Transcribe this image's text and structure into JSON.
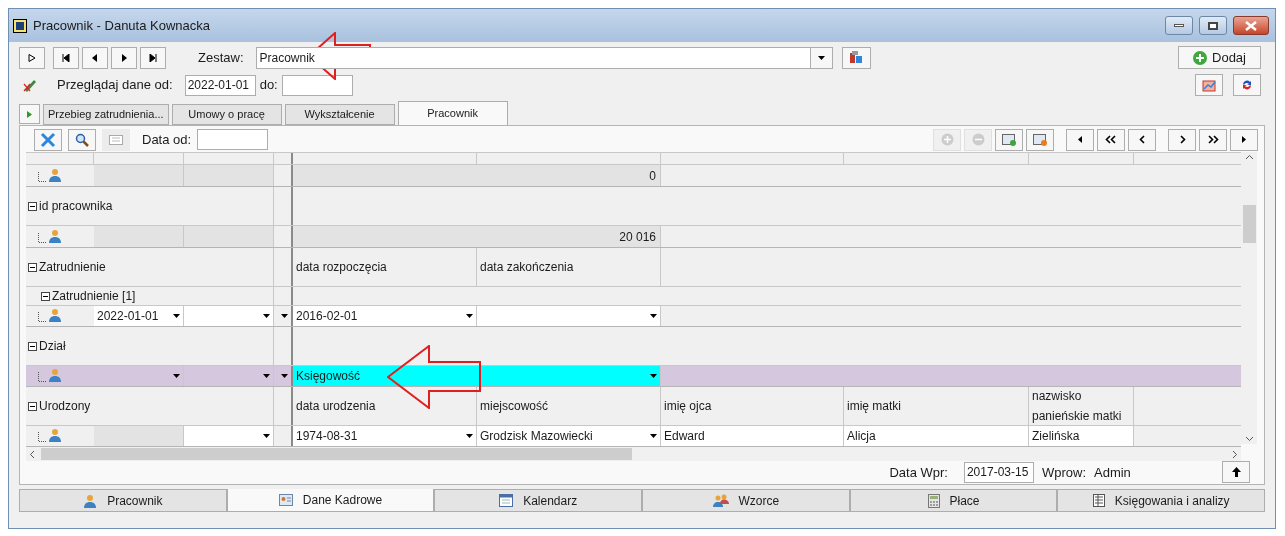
{
  "window": {
    "title": "Pracownik - Danuta Kownacka"
  },
  "toolbar": {
    "set_label": "Zestaw:",
    "set_value": "Pracownik",
    "add_button": "Dodaj",
    "browse_label": "Przeglądaj dane od:",
    "from_value": "2022-01-01",
    "to_label": "do:"
  },
  "tabs": [
    {
      "label": "Przebieg zatrudnienia...",
      "selected": false
    },
    {
      "label": "Umowy o pracę",
      "selected": false
    },
    {
      "label": "Wykształcenie",
      "selected": false
    },
    {
      "label": "Pracownik",
      "selected": true
    }
  ],
  "grid_toolbar": {
    "date_label": "Data od:"
  },
  "rows": [
    {
      "kind": "value",
      "value": "0"
    },
    {
      "kind": "group",
      "label": "id pracownika",
      "expanded": true,
      "headers": []
    },
    {
      "kind": "value",
      "value": "20 016"
    },
    {
      "kind": "group",
      "label": "Zatrudnienie",
      "expanded": true,
      "headers": [
        "data rozpoczęcia",
        "data zakończenia"
      ]
    },
    {
      "kind": "subgroup",
      "label": "Zatrudnienie [1]",
      "expanded": true
    },
    {
      "kind": "fields",
      "selected": false,
      "cells": [
        {
          "kind": "dropdown",
          "value": "2022-01-01"
        },
        {
          "kind": "dropdown"
        },
        {
          "kind": "arrow"
        },
        {
          "kind": "dropdown",
          "value": "2016-02-01"
        },
        {
          "kind": "dropdown"
        }
      ]
    },
    {
      "kind": "group",
      "label": "Dział",
      "expanded": true,
      "headers": []
    },
    {
      "kind": "fields",
      "selected": true,
      "cells": [
        {
          "kind": "dropdown"
        },
        {
          "kind": "dropdown"
        },
        {
          "kind": "arrow"
        },
        {
          "kind": "wide",
          "value": "Księgowość",
          "focused": true
        }
      ]
    },
    {
      "kind": "group",
      "label": "Urodzony",
      "expanded": true,
      "headers": [
        "data urodzenia",
        "miejscowość",
        "imię ojca",
        "imię matki",
        "nazwisko panieńskie matki"
      ]
    },
    {
      "kind": "fields",
      "selected": false,
      "cells": [
        {
          "kind": "readonly"
        },
        {
          "kind": "dropdown"
        },
        {
          "kind": "blank"
        },
        {
          "kind": "dropdown",
          "value": "1974-08-31"
        },
        {
          "kind": "dropdown",
          "value": "Grodzisk Mazowiecki"
        },
        {
          "kind": "text",
          "value": "Edward"
        },
        {
          "kind": "text",
          "value": "Alicja"
        },
        {
          "kind": "text",
          "value": "Zielińska"
        }
      ]
    }
  ],
  "footer": {
    "entry_date_label": "Data Wpr:",
    "entry_date": "2017-03-15",
    "entered_by_label": "Wprow:",
    "entered_by": "Admin"
  },
  "bottom_tabs": [
    {
      "label": "Pracownik",
      "selected": false
    },
    {
      "label": "Dane Kadrowe",
      "selected": true
    },
    {
      "label": "Kalendarz",
      "selected": false
    },
    {
      "label": "Wzorce",
      "selected": false
    },
    {
      "label": "Płace",
      "selected": false
    },
    {
      "label": "Księgowania i analizy",
      "selected": false
    }
  ]
}
